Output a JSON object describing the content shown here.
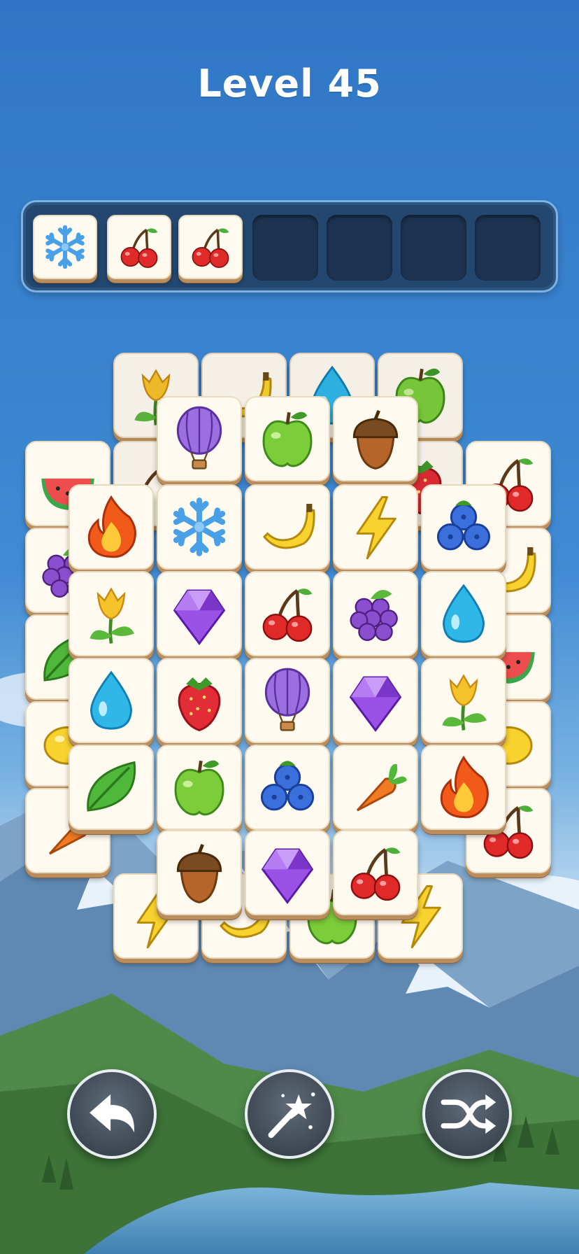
{
  "level": {
    "title": "Level 45"
  },
  "tray": {
    "slots": [
      "snowflake",
      "cherry",
      "cherry",
      "",
      "",
      "",
      ""
    ]
  },
  "board": {
    "layer0": [
      [
        "tulip",
        "banana",
        "drop",
        "apple"
      ],
      [
        "watermelon",
        "cherry-hidden",
        "strawberry",
        "cherry"
      ],
      [
        "grapes",
        "",
        "",
        "banana"
      ],
      [
        "leaf",
        "",
        "",
        "watermelon"
      ],
      [
        "lemon",
        "",
        "",
        "lemon"
      ],
      [
        "carrot",
        "",
        "",
        "cherry"
      ],
      [
        "lightning",
        "banana",
        "apple",
        "lightning"
      ]
    ],
    "layer1_top": [
      "balloon",
      "apple",
      "acorn"
    ],
    "layer1_grid": [
      [
        "fire",
        "snowflake",
        "banana",
        "lightning",
        "blueberry"
      ],
      [
        "tulip",
        "gem",
        "cherry",
        "grapes",
        "drop"
      ],
      [
        "drop",
        "strawberry",
        "balloon",
        "gem",
        "tulip"
      ],
      [
        "leaf",
        "apple",
        "blueberry",
        "carrot",
        "fire"
      ]
    ],
    "layer1_bottom": [
      "acorn",
      "gem",
      "cherry"
    ]
  },
  "controls": {
    "undo_icon": "undo-icon",
    "magic_icon": "magic-wand-icon",
    "shuffle_icon": "shuffle-icon"
  }
}
